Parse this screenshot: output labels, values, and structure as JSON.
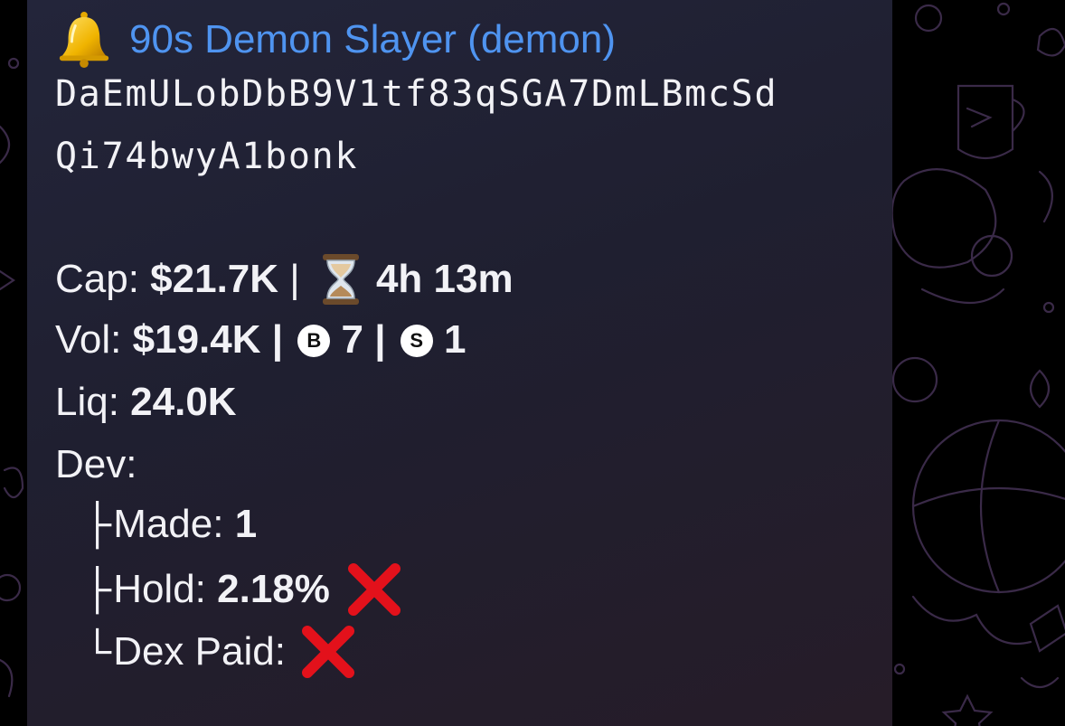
{
  "message": {
    "title": "90s Demon Slayer (demon)",
    "address_line1": "DaEmULobDbB9V1tf83qSGA7DmLBmcSd",
    "address_line2": "Qi74bwyA1bonk",
    "cap": {
      "label": "Cap: ",
      "value": "$21.7K",
      "sep": " | ",
      "age": "4h 13m"
    },
    "vol": {
      "label": "Vol: ",
      "value": "$19.4K",
      "sep1": " | ",
      "buy_badge": "B",
      "buys": " 7",
      "sep2": " | ",
      "sell_badge": "S",
      "sells": " 1"
    },
    "liq": {
      "label": "Liq: ",
      "value": "24.0K"
    },
    "dev": {
      "label": "Dev:",
      "made": {
        "prefix": "├",
        "label": "Made: ",
        "value": "1"
      },
      "hold": {
        "prefix": "├",
        "label": "Hold: ",
        "value": "2.18%"
      },
      "dex_paid": {
        "prefix": "└",
        "label": "Dex Paid: "
      }
    }
  },
  "icons": {
    "title_icon": "bell-icon",
    "age_icon": "hourglass-icon",
    "fail_icon": "red-cross-icon"
  },
  "colors": {
    "link": "#4f94f0",
    "bubble": "#23253a",
    "text": "#f2f2f6",
    "cross": "#e3111b"
  }
}
